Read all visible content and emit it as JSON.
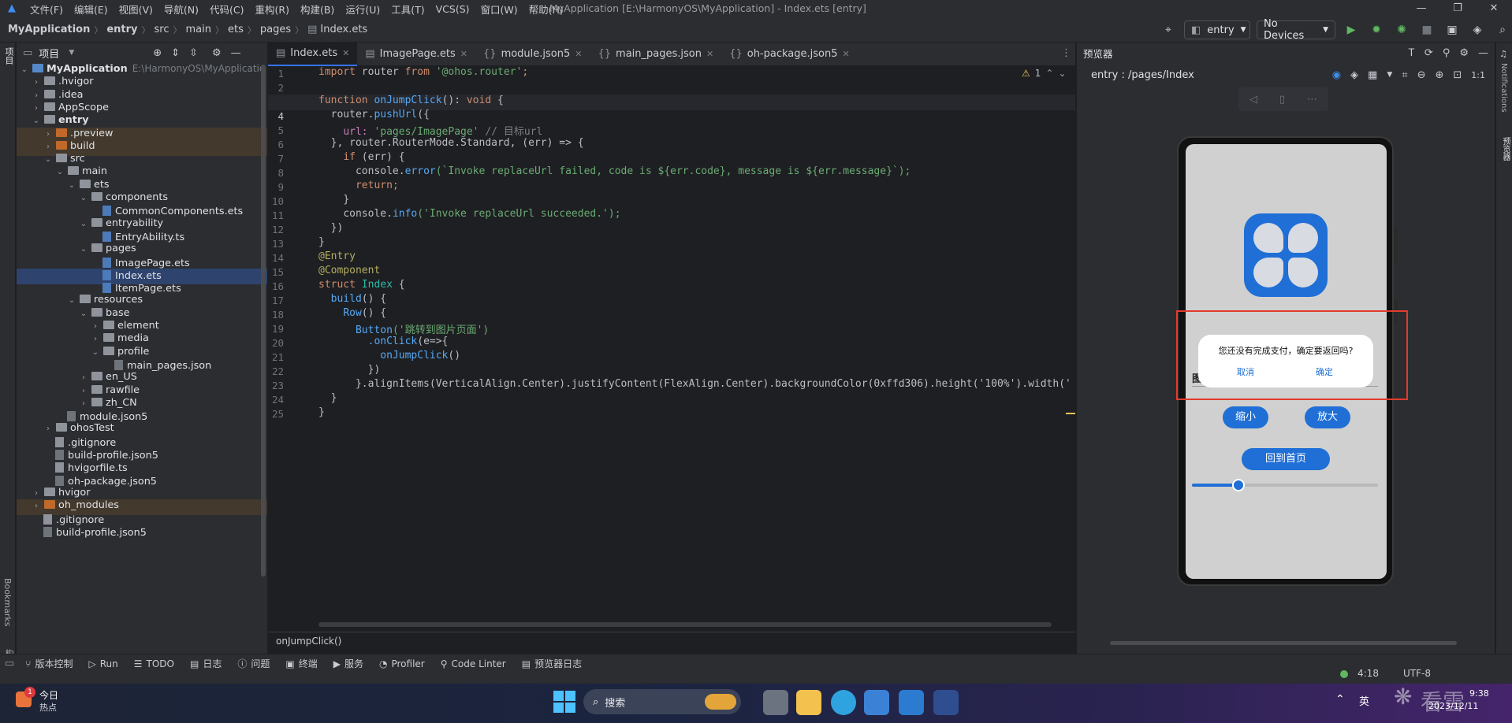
{
  "menubar": {
    "items": [
      "文件(F)",
      "编辑(E)",
      "视图(V)",
      "导航(N)",
      "代码(C)",
      "重构(R)",
      "构建(B)",
      "运行(U)",
      "工具(T)",
      "VCS(S)",
      "窗口(W)",
      "帮助(H)"
    ],
    "window_title": "MyApplication [E:\\HarmonyOS\\MyApplication] - Index.ets [entry]"
  },
  "navbar": {
    "breadcrumbs": [
      "MyApplication",
      "entry",
      "src",
      "main",
      "ets",
      "pages",
      "Index.ets"
    ],
    "module_select": "entry",
    "device_select": "No Devices"
  },
  "left_strip": {
    "project": "项目",
    "bookmarks": "Bookmarks",
    "structure": "结构"
  },
  "project_panel": {
    "title": "项目",
    "items": [
      {
        "label": "MyApplication",
        "path": "E:\\HarmonyOS\\MyApplicatio"
      },
      {
        "label": ".hvigor"
      },
      {
        "label": ".idea"
      },
      {
        "label": "AppScope"
      },
      {
        "label": "entry"
      },
      {
        "label": ".preview"
      },
      {
        "label": "build"
      },
      {
        "label": "src"
      },
      {
        "label": "main"
      },
      {
        "label": "ets"
      },
      {
        "label": "components"
      },
      {
        "label": "CommonComponents.ets"
      },
      {
        "label": "entryability"
      },
      {
        "label": "EntryAbility.ts"
      },
      {
        "label": "pages"
      },
      {
        "label": "ImagePage.ets"
      },
      {
        "label": "Index.ets"
      },
      {
        "label": "ItemPage.ets"
      },
      {
        "label": "resources"
      },
      {
        "label": "base"
      },
      {
        "label": "element"
      },
      {
        "label": "media"
      },
      {
        "label": "profile"
      },
      {
        "label": "main_pages.json"
      },
      {
        "label": "en_US"
      },
      {
        "label": "rawfile"
      },
      {
        "label": "zh_CN"
      },
      {
        "label": "module.json5"
      },
      {
        "label": "ohosTest"
      },
      {
        "label": ".gitignore"
      },
      {
        "label": "build-profile.json5"
      },
      {
        "label": "hvigorfile.ts"
      },
      {
        "label": "oh-package.json5"
      },
      {
        "label": "hvigor"
      },
      {
        "label": "oh_modules"
      },
      {
        "label": ".gitignore"
      },
      {
        "label": "build-profile.json5"
      }
    ]
  },
  "editor": {
    "tabs": [
      "Index.ets",
      "ImagePage.ets",
      "module.json5",
      "main_pages.json",
      "oh-package.json5"
    ],
    "warning_count": "1",
    "line_numbers": [
      "1",
      "2",
      "3",
      "4",
      "5",
      "6",
      "7",
      "8",
      "9",
      "10",
      "11",
      "12",
      "13",
      "14",
      "15",
      "16",
      "17",
      "18",
      "19",
      "20",
      "21",
      "22",
      "23",
      "24",
      "25"
    ],
    "code": {
      "l1": [
        "import",
        "router",
        "from",
        "'@ohos.router'",
        ";"
      ],
      "l3": [
        "function",
        "onJumpClick",
        "(): ",
        "void",
        " {"
      ],
      "l4": [
        "router.",
        "pushUrl",
        "({"
      ],
      "l5": [
        "url: ",
        "'pages/ImagePage'",
        " // 目标url"
      ],
      "l6": [
        "}, router.RouterMode.Standard, (err) => {"
      ],
      "l7": [
        "if",
        " (err) {"
      ],
      "l8": [
        "console.",
        "error",
        "(`Invoke replaceUrl failed, code is ${err.code}, message is ${err.message}`);"
      ],
      "l9": [
        "return",
        ";"
      ],
      "l10": [
        "}"
      ],
      "l11": [
        "console.",
        "info",
        "('Invoke replaceUrl succeeded.');"
      ],
      "l12": [
        "})"
      ],
      "l13": [
        "}"
      ],
      "l14": [
        "@Entry"
      ],
      "l15": [
        "@Component"
      ],
      "l16": [
        "struct",
        "Index",
        " {"
      ],
      "l17": [
        "build",
        "() {"
      ],
      "l18": [
        "Row",
        "() {"
      ],
      "l19": [
        "Button",
        "('跳转到图片页面')"
      ],
      "l20": [
        ".onClick",
        "(e=>{"
      ],
      "l21": [
        "onJumpClick",
        "()"
      ],
      "l22": [
        "})"
      ],
      "l23": [
        "}.alignItems(VerticalAlign.Center).justifyContent(FlexAlign.Center).backgroundColor(0xffd306).height('100%').width('"
      ],
      "l24": [
        "}"
      ],
      "l25": [
        "}"
      ]
    },
    "breadcrumb_bottom": "onJumpClick()"
  },
  "preview": {
    "title": "预览器",
    "path": "entry : /pages/Index",
    "dialog_message": "您还没有完成支付，确定要返回吗?",
    "dialog_cancel": "取消",
    "dialog_confirm": "确定",
    "zoom_out": "缩小",
    "zoom_in": "放大",
    "home_button": "回到首页",
    "slider_value": 0.25,
    "right_strip_notifications": "Notifications",
    "right_strip_previewer": "预览器",
    "partial_label": "图"
  },
  "toolbar": {
    "items": [
      "版本控制",
      "Run",
      "TODO",
      "日志",
      "问题",
      "终端",
      "服务",
      "Profiler",
      "Code Linter",
      "预览器日志"
    ]
  },
  "status": {
    "position": "4:18",
    "encoding": "UTF-8"
  },
  "taskbar": {
    "news_title": "今日",
    "news_sub": "热点",
    "badge": "1",
    "search": "搜索",
    "lang": "英",
    "time": "9:38",
    "date": "2023/12/11",
    "watermark": "看雪"
  },
  "colors": {
    "accent": "#3574f0",
    "dialog_highlight": "#e23b2e",
    "phone_button": "#1f6fd6",
    "editor_bg": "#1e1f22"
  }
}
